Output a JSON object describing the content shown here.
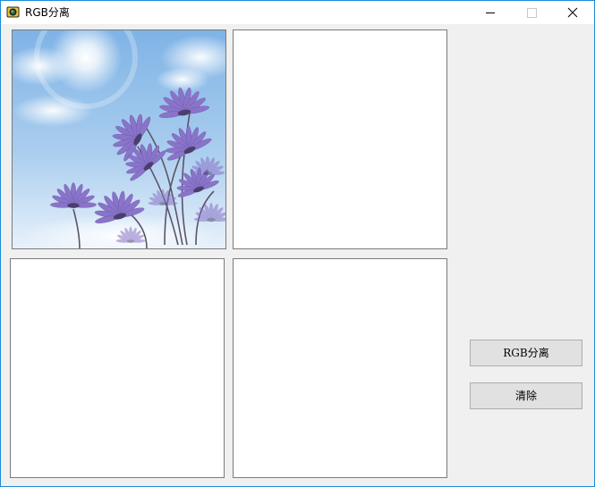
{
  "window": {
    "title": "RGB分离",
    "icon": "app-camera-icon",
    "controls": [
      "minimize-icon",
      "maximize-icon",
      "close-icon"
    ]
  },
  "picture_boxes": [
    {
      "name": "picture-box-original",
      "content": "flower-sky-image"
    },
    {
      "name": "picture-box-2",
      "content": ""
    },
    {
      "name": "picture-box-3",
      "content": ""
    },
    {
      "name": "picture-box-4",
      "content": ""
    }
  ],
  "buttons": {
    "rgb_split_label": "RGB分离",
    "clear_label": "清除"
  },
  "colors": {
    "window_border": "#1e8cd8",
    "client_bg": "#f0f0f0",
    "button_bg": "#e1e1e1",
    "button_border": "#adadad",
    "picture_border": "#7a7a7a"
  }
}
